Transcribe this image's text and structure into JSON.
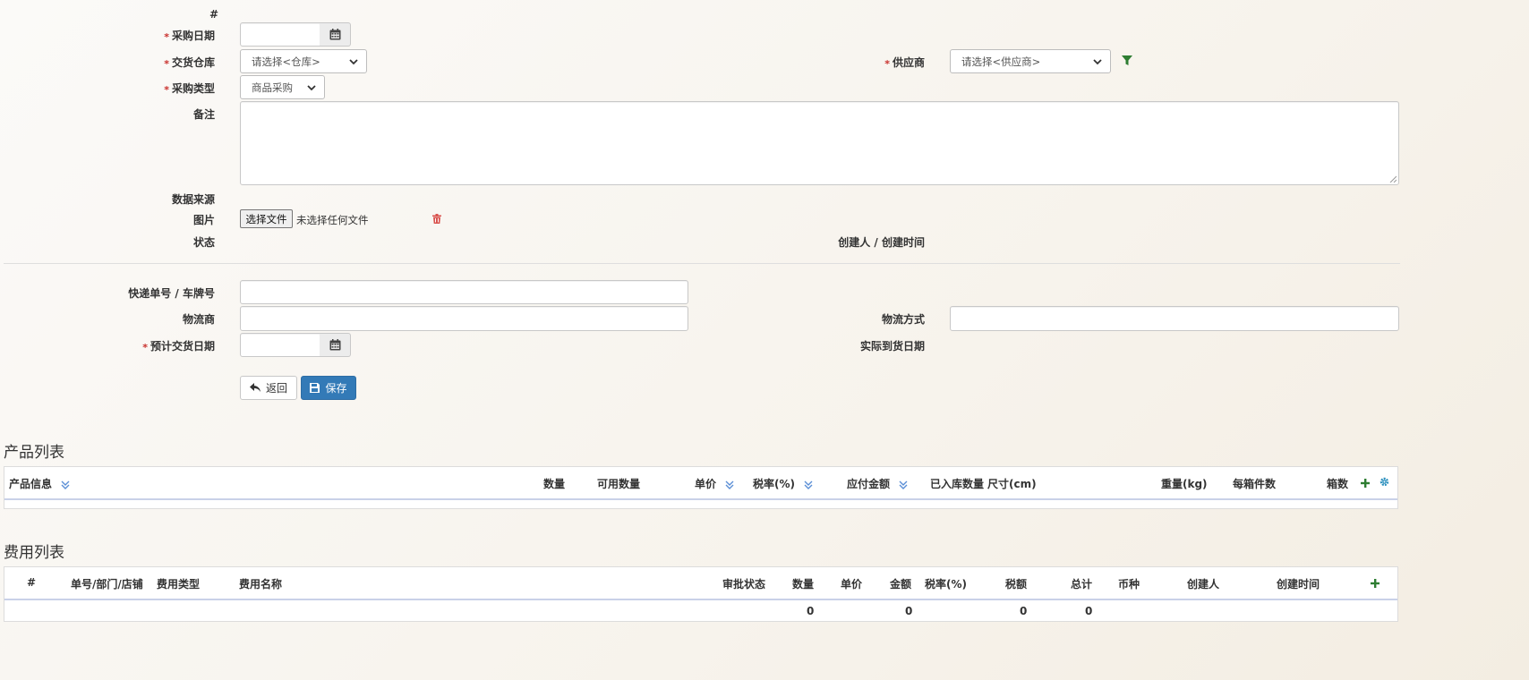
{
  "form": {
    "hash_label": "#",
    "purchase_date_label": "采购日期",
    "warehouse_label": "交货仓库",
    "warehouse_placeholder": "请选择<仓库>",
    "supplier_label": "供应商",
    "supplier_placeholder": "请选择<供应商>",
    "purchase_type_label": "采购类型",
    "purchase_type_value": "商品采购",
    "remark_label": "备注",
    "data_source_label": "数据来源",
    "image_label": "图片",
    "file_button_label": "选择文件",
    "file_status": "未选择任何文件",
    "status_label": "状态",
    "creator_label": "创建人 / 创建时间",
    "required_mark": "*"
  },
  "logistics": {
    "tracking_label": "快递单号 / 车牌号",
    "carrier_label": "物流商",
    "method_label": "物流方式",
    "expected_date_label": "预计交货日期",
    "actual_date_label": "实际到货日期"
  },
  "actions": {
    "back_label": "返回",
    "save_label": "保存"
  },
  "products": {
    "title": "产品列表",
    "columns": {
      "info": "产品信息",
      "qty": "数量",
      "available": "可用数量",
      "price": "单价",
      "tax_rate": "税率(%)",
      "payable": "应付金额",
      "received": "已入库数量",
      "size": "尺寸(cm)",
      "weight": "重量(kg)",
      "per_box": "每箱件数",
      "boxes": "箱数"
    }
  },
  "fees": {
    "title": "费用列表",
    "columns": {
      "hash": "#",
      "order": "单号/部门/店铺",
      "type": "费用类型",
      "name": "费用名称",
      "approval": "审批状态",
      "qty": "数量",
      "price": "单价",
      "amount": "金额",
      "tax_rate": "税率(%)",
      "tax": "税额",
      "total": "总计",
      "currency": "币种",
      "creator": "创建人",
      "created": "创建时间"
    },
    "totals": {
      "qty": "0",
      "amount": "0",
      "tax": "0",
      "total": "0"
    }
  },
  "colors": {
    "required": "#c9302c",
    "primary": "#337ab7",
    "filter": "#2e7d32",
    "sort": "#5b8fd6",
    "gear": "#2a8fbd",
    "trash": "#d9534f"
  }
}
